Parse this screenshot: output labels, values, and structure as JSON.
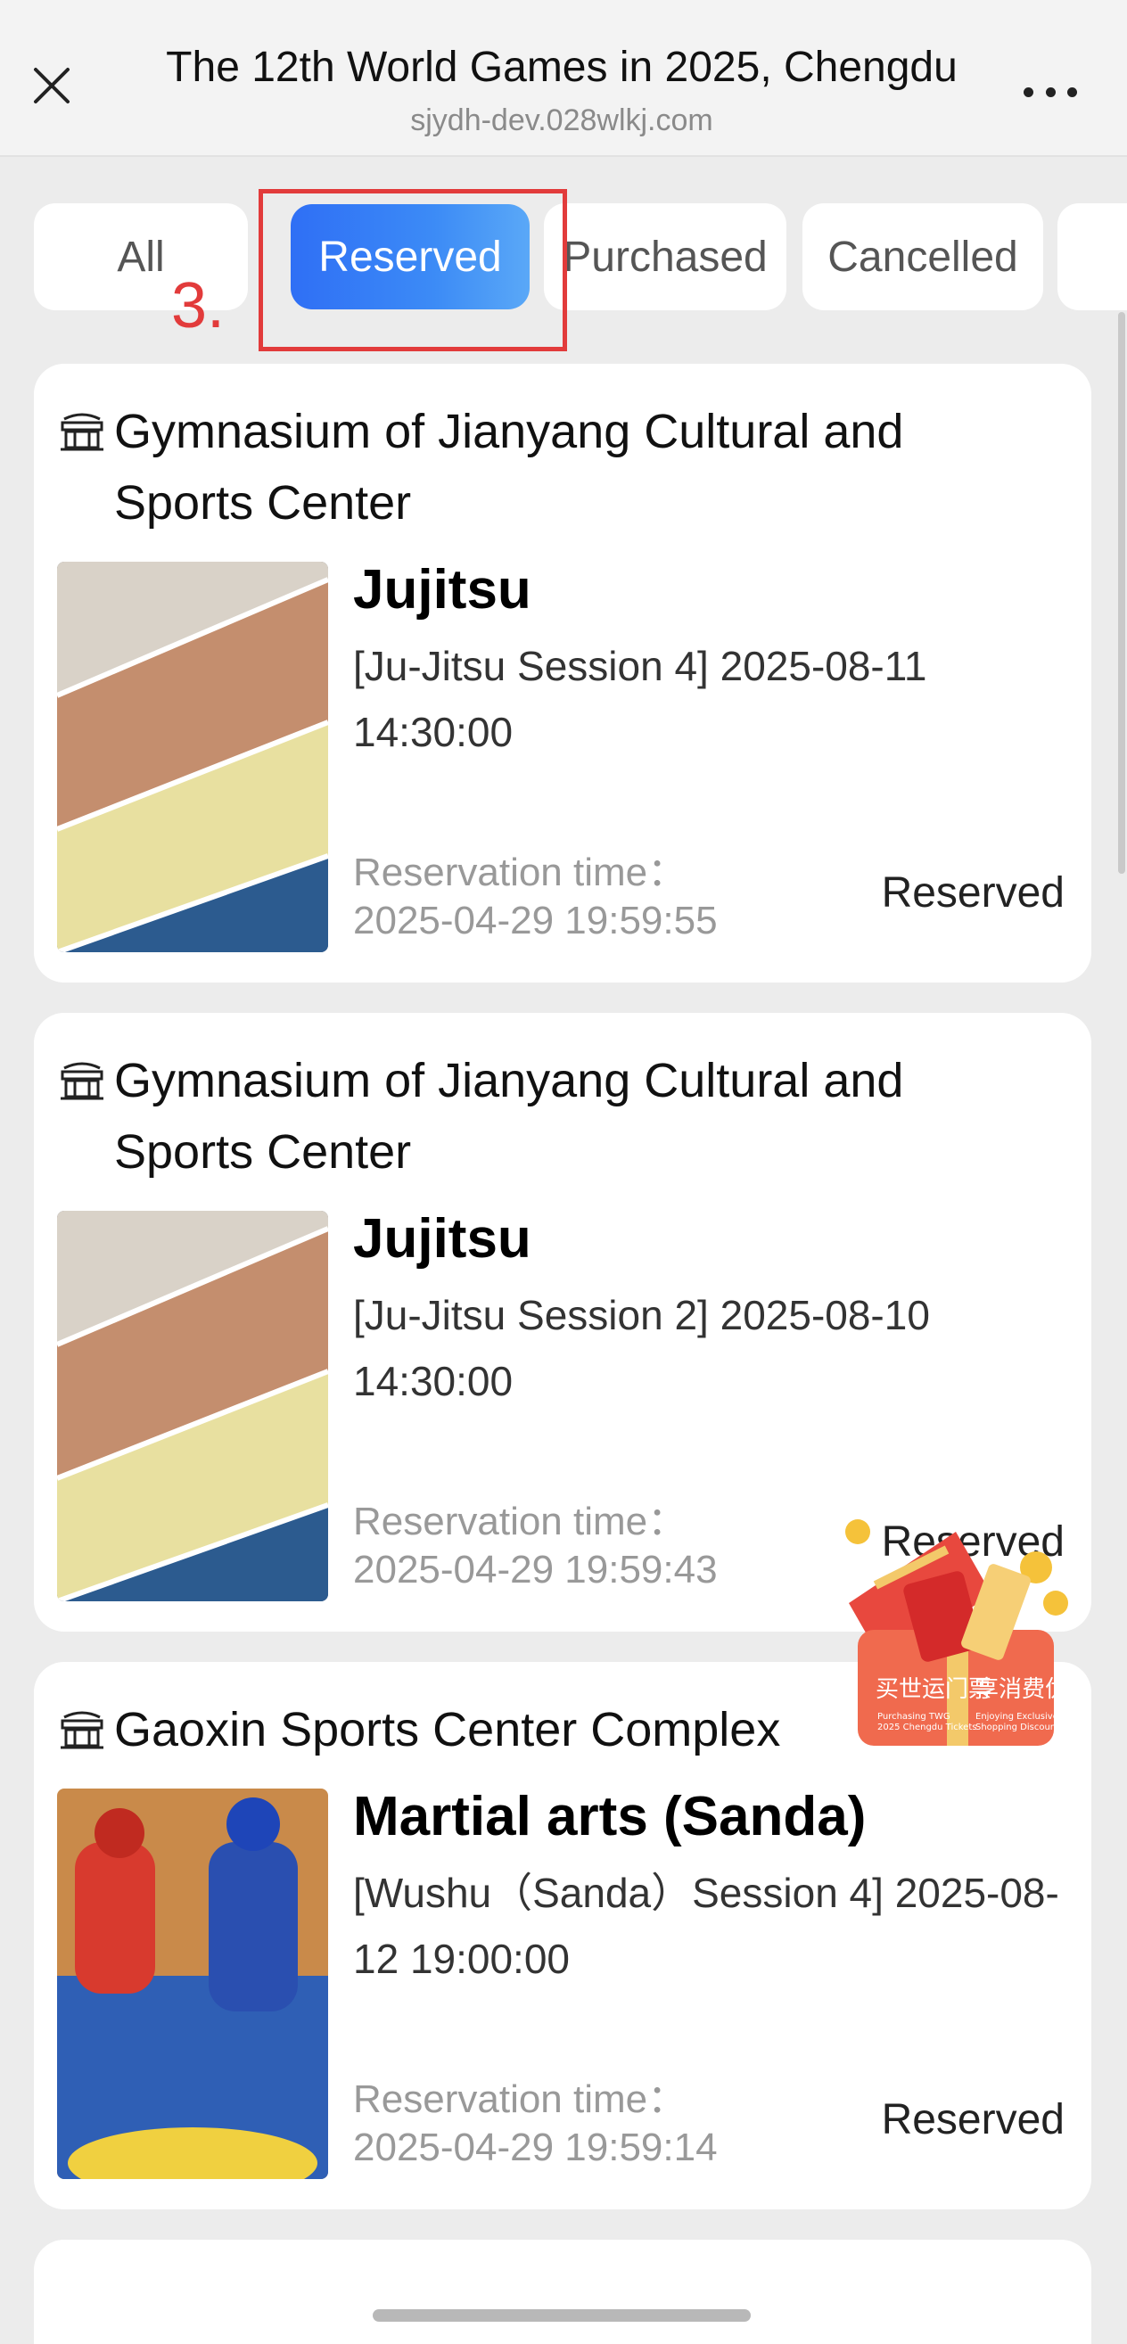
{
  "header": {
    "title": "The 12th World Games in 2025, Chengdu",
    "url": "sjydh-dev.028wlkj.com",
    "close_icon": "close-icon",
    "more_icon": "more-icon"
  },
  "tabs": [
    {
      "label": "All",
      "active": false
    },
    {
      "label": "Reserved",
      "active": true
    },
    {
      "label": "Purchased",
      "active": false
    },
    {
      "label": "Cancelled",
      "active": false
    }
  ],
  "annotation": {
    "label": "3.",
    "color": "#e23b3b"
  },
  "reservations": [
    {
      "venue": "Gymnasium of Jianyang Cultural and Sports Center",
      "sport": "Jujitsu",
      "session": " [Ju-Jitsu Session 4] 2025-08-11 14:30:00",
      "reservation_label": "Reservation time：",
      "reservation_time": "2025-04-29 19:59:55",
      "status": "Reserved"
    },
    {
      "venue": "Gymnasium of Jianyang Cultural and Sports Center",
      "sport": "Jujitsu",
      "session": " [Ju-Jitsu Session 2] 2025-08-10 14:30:00",
      "reservation_label": "Reservation time：",
      "reservation_time": "2025-04-29 19:59:43",
      "status": "Reserved"
    },
    {
      "venue": "Gaoxin Sports Center Complex",
      "sport": "Martial arts (Sanda)",
      "session": " [Wushu（Sanda）Session 4] 2025-08-12 19:00:00",
      "reservation_label": "Reservation time：",
      "reservation_time": "2025-04-29 19:59:14",
      "status": "Reserved"
    }
  ],
  "promo": {
    "left_text": "买世运门票",
    "left_sub": "Purchasing TWG 2025 Chengdu Tickets",
    "right_text": "享消费优惠",
    "right_sub": "Enjoying Exclusive Shopping Discounts"
  },
  "colors": {
    "accent": "#2f6ff5",
    "background": "#ececec",
    "card": "#ffffff"
  }
}
